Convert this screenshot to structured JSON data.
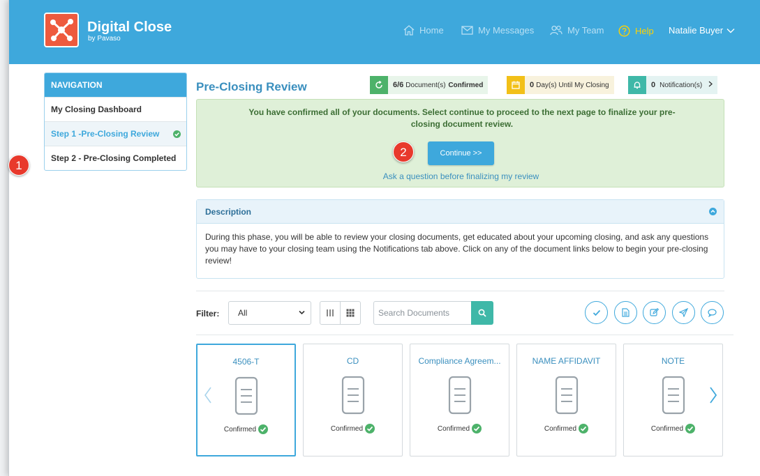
{
  "header": {
    "app_title": "Digital Close",
    "app_subtitle": "by Pavaso",
    "home": "Home",
    "messages": "My Messages",
    "team": "My Team",
    "help": "Help",
    "user": "Natalie Buyer"
  },
  "sidebar": {
    "heading": "NAVIGATION",
    "items": [
      {
        "label": "My Closing Dashboard"
      },
      {
        "label": "Step 1 -Pre-Closing Review"
      },
      {
        "label": "Step 2 - Pre-Closing Completed"
      }
    ]
  },
  "callouts": {
    "one": "1",
    "two": "2"
  },
  "main": {
    "title": "Pre-Closing Review",
    "stats": {
      "docs_count": "6/6",
      "docs_text": "Document(s)",
      "docs_bold": "Confirmed",
      "days_count": "0",
      "days_text": "Day(s) Until My Closing",
      "notif_count": "0",
      "notif_text": "Notification(s)"
    },
    "confirm": {
      "message": "You have confirmed all of your documents. Select continue to proceed to the next page to finalize your pre-closing document review.",
      "continue_label": "Continue >>",
      "ask_link": "Ask a question before finalizing my review"
    },
    "description": {
      "heading": "Description",
      "body": "During this phase, you will be able to review your closing documents, get educated about your upcoming closing, and ask any questions you may have to your closing team using the Notifications tab above. Click on any of the document links below to begin your pre-closing review!"
    },
    "toolbar": {
      "filter_label": "Filter:",
      "filter_value": "All",
      "search_placeholder": "Search Documents"
    },
    "documents": [
      {
        "name": "4506-T",
        "status": "Confirmed"
      },
      {
        "name": "CD",
        "status": "Confirmed"
      },
      {
        "name": "Compliance Agreem...",
        "status": "Confirmed"
      },
      {
        "name": "NAME AFFIDAVIT",
        "status": "Confirmed"
      },
      {
        "name": "NOTE",
        "status": "Confirmed"
      }
    ]
  },
  "colors": {
    "header_blue": "#3ea8dc",
    "logo_orange": "#ee5a3e",
    "success_green": "#4db26a",
    "warning_yellow": "#f2c018",
    "teal": "#3fb8a8",
    "callout_red": "#e8392c"
  }
}
